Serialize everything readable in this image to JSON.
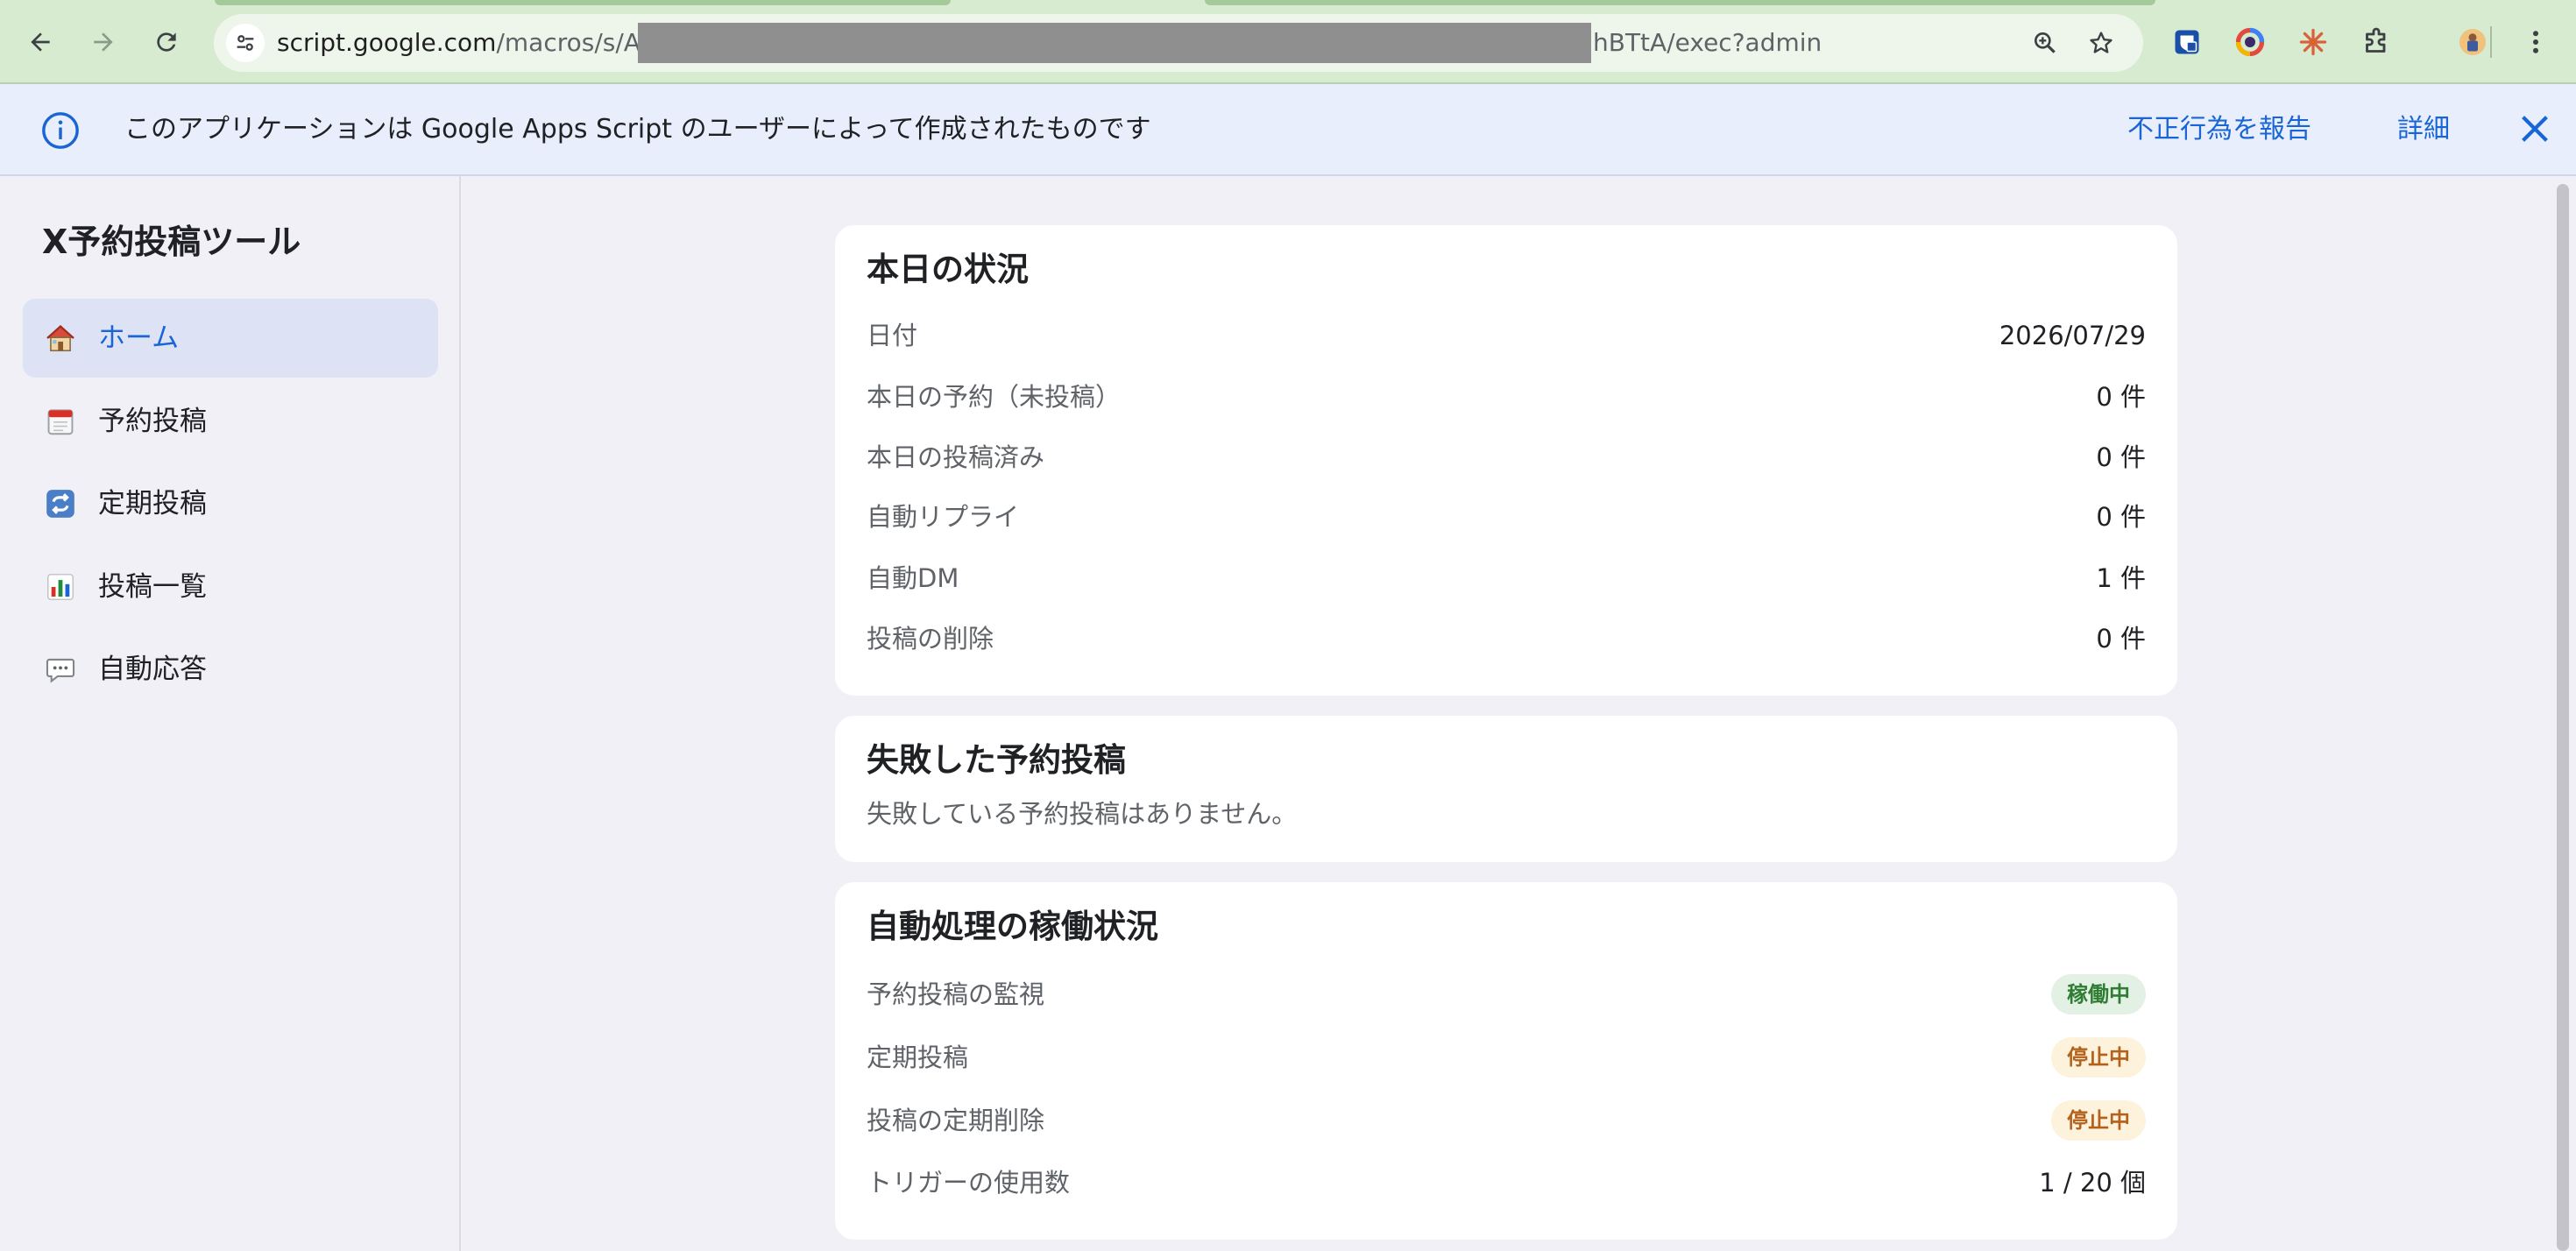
{
  "browser": {
    "url_host": "script.google.com",
    "url_path": "/macros/s/AK",
    "url_tail": "hBTtA/exec?admin"
  },
  "banner": {
    "message": "このアプリケーションは Google Apps Script のユーザーによって作成されたものです",
    "report_link": "不正行為を報告",
    "details_link": "詳細"
  },
  "sidebar": {
    "app_title": "X予約投稿ツール",
    "items": [
      {
        "label": "ホーム",
        "icon": "house-icon",
        "active": true
      },
      {
        "label": "予約投稿",
        "icon": "calendar-icon",
        "active": false
      },
      {
        "label": "定期投稿",
        "icon": "repeat-icon",
        "active": false
      },
      {
        "label": "投稿一覧",
        "icon": "bar-chart-icon",
        "active": false
      },
      {
        "label": "自動応答",
        "icon": "speech-bubble-icon",
        "active": false
      }
    ]
  },
  "today": {
    "title": "本日の状況",
    "rows": [
      {
        "label": "日付",
        "value": "2026/07/29"
      },
      {
        "label": "本日の予約（未投稿）",
        "value": "0 件"
      },
      {
        "label": "本日の投稿済み",
        "value": "0 件"
      },
      {
        "label": "自動リプライ",
        "value": "0 件"
      },
      {
        "label": "自動DM",
        "value": "1 件"
      },
      {
        "label": "投稿の削除",
        "value": "0 件"
      }
    ]
  },
  "failed": {
    "title": "失敗した予約投稿",
    "empty_message": "失敗している予約投稿はありません。"
  },
  "automation": {
    "title": "自動処理の稼働状況",
    "rows": [
      {
        "label": "予約投稿の監視",
        "status": "稼働中",
        "state": "running"
      },
      {
        "label": "定期投稿",
        "status": "停止中",
        "state": "stopped"
      },
      {
        "label": "投稿の定期削除",
        "status": "停止中",
        "state": "stopped"
      }
    ],
    "trigger_label": "トリガーの使用数",
    "trigger_value": "1 / 20 個"
  },
  "colors": {
    "accent": "#1a65d6",
    "running_bg": "#e3f1e5",
    "running_fg": "#2e7d32",
    "stopped_bg": "#fdf2dc",
    "stopped_fg": "#b3611b",
    "chrome_green": "#d7ebd0"
  }
}
